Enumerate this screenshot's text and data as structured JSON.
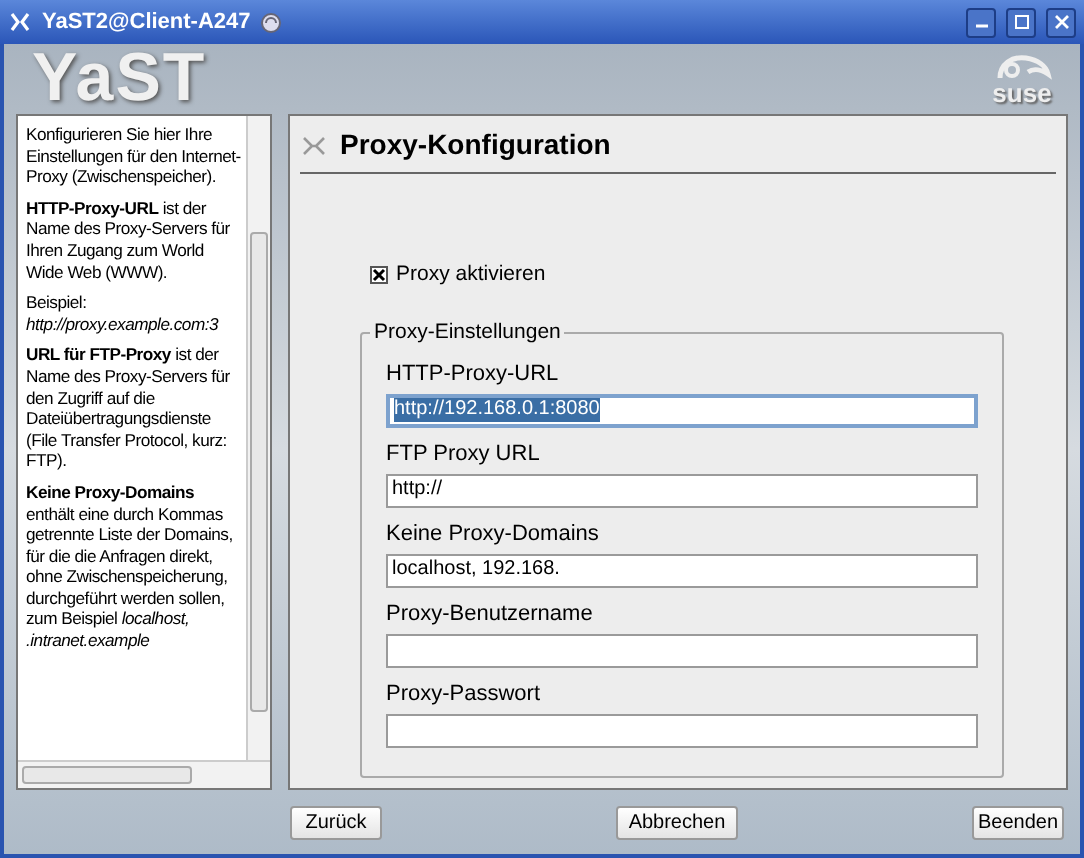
{
  "window": {
    "title": "YaST2@Client-A247"
  },
  "header": {
    "logo": "YaST",
    "brand": "suse"
  },
  "help": {
    "paragraphs": [
      "Konfigurieren Sie hier Ihre Einstellungen für den Internet-Proxy (Zwischenspeicher).",
      "**HTTP-Proxy-URL** ist der Name des Proxy-Servers für Ihren Zugang zum World Wide Web (WWW).",
      "Beispiel: *http://proxy.example.com:3*",
      "**URL für FTP-Proxy** ist der Name des Proxy-Servers für den Zugriff auf die Dateiübertragungsdienste (File Transfer Protocol, kurz: FTP).",
      "**Keine Proxy-Domains** enthält eine durch Kommas getrennte Liste der Domains, für die die Anfragen direkt, ohne Zwischenspeicherung, durchgeführt werden sollen, zum Beispiel *localhost, .intranet.example*"
    ]
  },
  "dialog": {
    "title": "Proxy-Konfiguration",
    "enable": {
      "label": "Proxy aktivieren",
      "checked": true
    },
    "group": {
      "title": "Proxy-Einstellungen",
      "fields": [
        {
          "label": "HTTP-Proxy-URL",
          "value": "http://192.168.0.1:8080",
          "highlighted": true
        },
        {
          "label": "FTP Proxy URL",
          "value": "http://",
          "highlighted": false
        },
        {
          "label": "Keine Proxy-Domains",
          "value": "localhost, 192.168.",
          "highlighted": false
        },
        {
          "label": "Proxy-Benutzername",
          "highlighted": false
        },
        {
          "label": "Proxy-Passwort",
          "highlighted": false
        }
      ]
    }
  },
  "buttons": [
    "Zurück",
    "Abbrechen",
    "Beenden"
  ]
}
